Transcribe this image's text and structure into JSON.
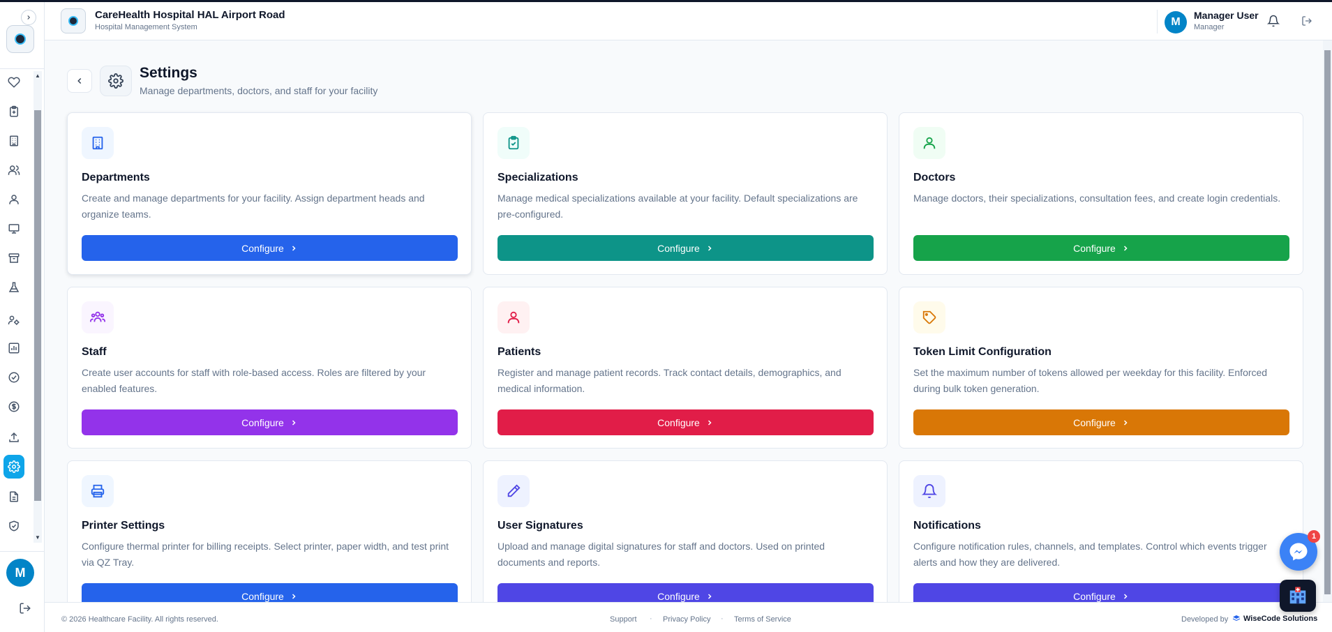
{
  "header": {
    "facility_name": "CareHealth Hospital HAL Airport Road",
    "system_name": "Hospital Management System",
    "user_initial": "M",
    "user_name": "Manager User",
    "user_role": "Manager"
  },
  "sidebar": {
    "user_initial": "M",
    "items": [
      {
        "icon": "heart-icon"
      },
      {
        "icon": "clipboard-plus-icon"
      },
      {
        "icon": "building-icon"
      },
      {
        "icon": "users-icon"
      },
      {
        "icon": "user-icon"
      },
      {
        "icon": "monitor-icon"
      },
      {
        "icon": "archive-icon"
      },
      {
        "icon": "flask-icon"
      },
      {
        "icon": "users-cog-icon"
      },
      {
        "icon": "bar-chart-icon"
      },
      {
        "icon": "check-circle-icon"
      },
      {
        "icon": "dollar-circle-icon"
      },
      {
        "icon": "upload-icon"
      },
      {
        "icon": "gear-icon",
        "active": true
      },
      {
        "icon": "file-text-icon"
      },
      {
        "icon": "shield-check-icon"
      }
    ]
  },
  "page": {
    "title": "Settings",
    "subtitle": "Manage departments, doctors, and staff for your facility"
  },
  "cards": [
    {
      "title": "Departments",
      "description": "Create and manage departments for your facility. Assign department heads and organize teams.",
      "button": "Configure",
      "color": "#2563eb",
      "icon": "building-icon",
      "icon_bg": "#eff6ff",
      "icon_color": "#2563eb"
    },
    {
      "title": "Specializations",
      "description": "Manage medical specializations available at your facility. Default specializations are pre-configured.",
      "button": "Configure",
      "color": "#0d9488",
      "icon": "clipboard-check-icon",
      "icon_bg": "#f0fdfa",
      "icon_color": "#0d9488"
    },
    {
      "title": "Doctors",
      "description": "Manage doctors, their specializations, consultation fees, and create login credentials.",
      "button": "Configure",
      "color": "#16a34a",
      "icon": "user-icon",
      "icon_bg": "#f0fdf4",
      "icon_color": "#16a34a"
    },
    {
      "title": "Staff",
      "description": "Create user accounts for staff with role-based access. Roles are filtered by your enabled features.",
      "button": "Configure",
      "color": "#9333ea",
      "icon": "users-icon",
      "icon_bg": "#faf5ff",
      "icon_color": "#9333ea"
    },
    {
      "title": "Patients",
      "description": "Register and manage patient records. Track contact details, demographics, and medical information.",
      "button": "Configure",
      "color": "#e11d48",
      "icon": "user-icon",
      "icon_bg": "#fff1f2",
      "icon_color": "#e11d48"
    },
    {
      "title": "Token Limit Configuration",
      "description": "Set the maximum number of tokens allowed per weekday for this facility. Enforced during bulk token generation.",
      "button": "Configure",
      "color": "#d97706",
      "icon": "tag-icon",
      "icon_bg": "#fffbeb",
      "icon_color": "#d97706"
    },
    {
      "title": "Printer Settings",
      "description": "Configure thermal printer for billing receipts. Select printer, paper width, and test print via QZ Tray.",
      "button": "Configure",
      "color": "#2563eb",
      "icon": "printer-icon",
      "icon_bg": "#eff6ff",
      "icon_color": "#2563eb"
    },
    {
      "title": "User Signatures",
      "description": "Upload and manage digital signatures for staff and doctors. Used on printed documents and reports.",
      "button": "Configure",
      "color": "#4f46e5",
      "icon": "pen-icon",
      "icon_bg": "#eef2ff",
      "icon_color": "#4f46e5"
    },
    {
      "title": "Notifications",
      "description": "Configure notification rules, channels, and templates. Control which events trigger alerts and how they are delivered.",
      "button": "Configure",
      "color": "#4f46e5",
      "icon": "bell-icon",
      "icon_bg": "#eef2ff",
      "icon_color": "#4f46e5"
    }
  ],
  "footer": {
    "copyright": "© 2026 Healthcare Facility. All rights reserved.",
    "links": [
      "Support",
      "Privacy Policy",
      "Terms of Service"
    ],
    "developed_by": "Developed by",
    "brand": "WiseCode Solutions"
  },
  "chat": {
    "badge": "1"
  }
}
